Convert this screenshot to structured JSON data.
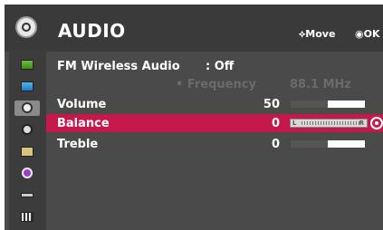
{
  "header": {
    "title": "AUDIO",
    "icon": "audio-settings-icon",
    "hint_move": "Move",
    "hint_ok": "OK"
  },
  "sidebar": {
    "items": [
      {
        "icon": "picture-icon"
      },
      {
        "icon": "screen-icon"
      },
      {
        "icon": "audio-icon",
        "selected": true
      },
      {
        "icon": "time-icon"
      },
      {
        "icon": "setup-icon"
      },
      {
        "icon": "option-icon"
      },
      {
        "icon": "input-icon"
      },
      {
        "icon": "media-icon"
      }
    ]
  },
  "rows": {
    "fm": {
      "label": "FM Wireless Audio",
      "state": ": Off"
    },
    "frequency": {
      "label": "• Frequency",
      "value": "88.1 MHz"
    },
    "volume": {
      "label": "Volume",
      "value": "50",
      "level": 0.5
    },
    "balance": {
      "label": "Balance",
      "value": "0",
      "left_marker": "L",
      "right_marker": "R",
      "position": 0.5
    },
    "treble": {
      "label": "Treble",
      "value": "0",
      "level": 0.5
    }
  },
  "colors": {
    "background": "#4a4a4a",
    "header": "#3a3a3a",
    "highlight": "#c4194a",
    "disabled_text": "#6b6b6b"
  }
}
